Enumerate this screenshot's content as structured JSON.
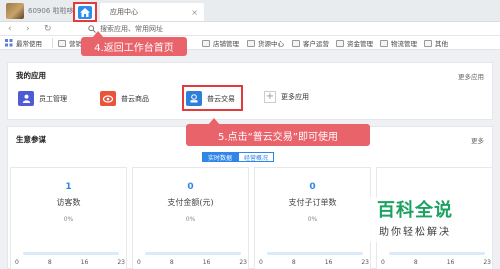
{
  "topbar": {
    "user_label": "60906 啦啦哆",
    "app_tab_label": "应用中心",
    "app_tab_close": "×"
  },
  "addressbar": {
    "back": "‹",
    "forward": "›",
    "refresh": "↻",
    "search_placeholder": "搜索应用、常用网址"
  },
  "bookmarks": [
    {
      "label": "最常使用"
    },
    {
      "label": "营销"
    },
    {
      "label": "店铺管理"
    },
    {
      "label": "货源中心"
    },
    {
      "label": "客户运营"
    },
    {
      "label": "资金管理"
    },
    {
      "label": "物流管理"
    },
    {
      "label": "其他"
    }
  ],
  "callouts": {
    "step4": "4.返回工作台首页",
    "step5": "5.点击“普云交易”即可使用"
  },
  "my_apps": {
    "title": "我的应用",
    "more": "更多应用",
    "items": [
      {
        "label": "员工管理",
        "color": "#4f5bd5"
      },
      {
        "label": "普云商品",
        "color": "#e8553b"
      },
      {
        "label": "普云交易",
        "color": "#2e7fd8"
      },
      {
        "label": "更多应用"
      }
    ]
  },
  "biz": {
    "title": "生意参谋",
    "more": "更多",
    "tabs": [
      {
        "label": "实时数据",
        "active": true
      },
      {
        "label": "经营概况",
        "active": false
      }
    ],
    "stats": [
      {
        "value": "1",
        "name": "访客数",
        "pct": "0%"
      },
      {
        "value": "0",
        "name": "支付金额(元)",
        "pct": "0%"
      },
      {
        "value": "0",
        "name": "支付子订单数",
        "pct": "0%"
      },
      {
        "value": "",
        "name": "",
        "pct": ""
      }
    ],
    "ticks": [
      "0",
      "8",
      "16",
      "23"
    ]
  },
  "watermark": {
    "big": "百科全说",
    "small": "助你轻松解决"
  },
  "colors": {
    "accent": "#2f86e8",
    "callout": "#e9636b",
    "highlight": "#e33b3b",
    "watermark_green": "#1aa260"
  }
}
